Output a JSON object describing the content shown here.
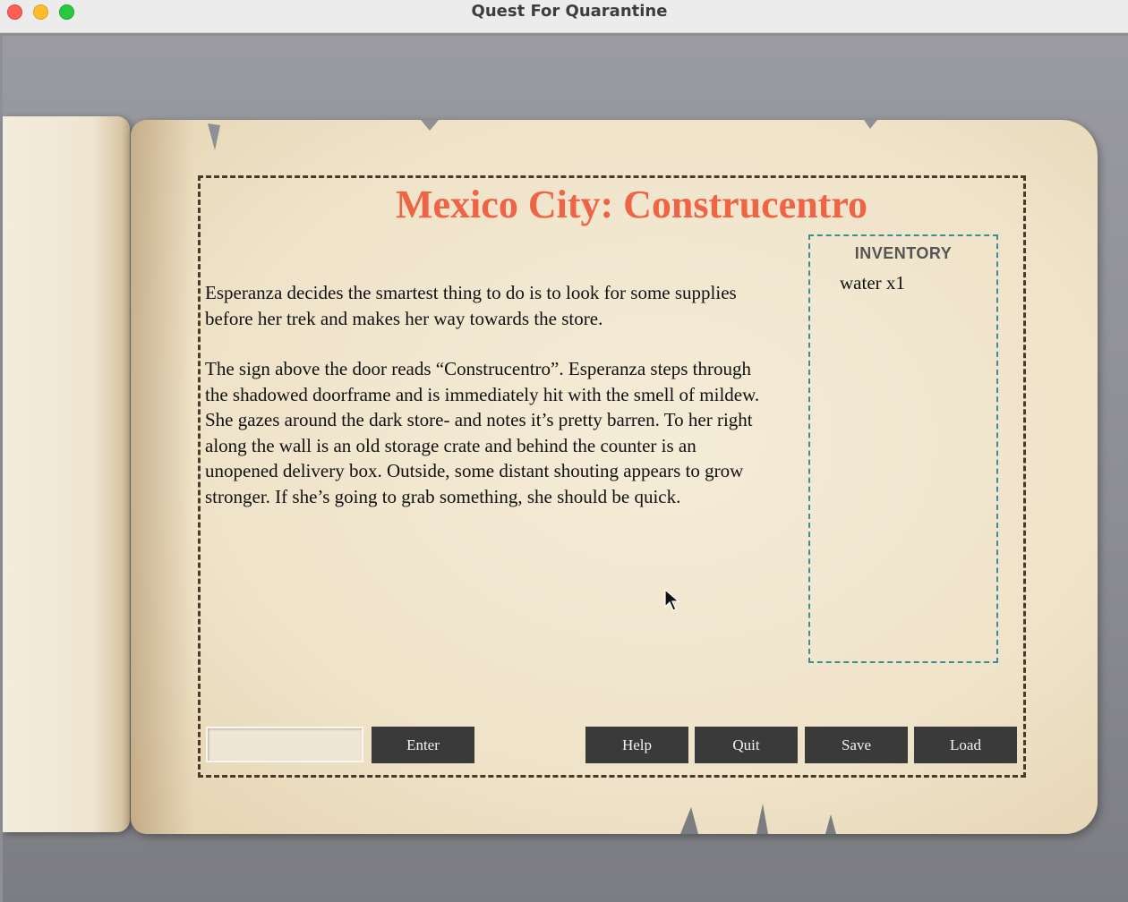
{
  "window": {
    "title": "Quest For Quarantine"
  },
  "location": {
    "title": "Mexico City: Construcentro"
  },
  "story": {
    "paragraphs": [
      "Esperanza decides the smartest thing to do is to look for some supplies before her trek and makes her way towards the store.",
      "The sign above the door reads “Construcentro”. Esperanza steps through the shadowed doorframe and is immediately hit with the smell of mildew. She gazes around the dark store- and notes it’s pretty barren. To her right along the wall is an old storage crate and behind the counter is an unopened delivery box. Outside, some distant shouting appears to grow stronger. If she’s going to grab something, she should be quick."
    ]
  },
  "inventory": {
    "title": "INVENTORY",
    "items": [
      "water x1"
    ]
  },
  "controls": {
    "input_value": "",
    "enter_label": "Enter",
    "help_label": "Help",
    "quit_label": "Quit",
    "save_label": "Save",
    "load_label": "Load"
  },
  "colors": {
    "title_accent": "#ee6445",
    "inventory_border": "#3b8e95",
    "button_bg": "#3a3a3a",
    "frame_border": "#4a3b28"
  }
}
